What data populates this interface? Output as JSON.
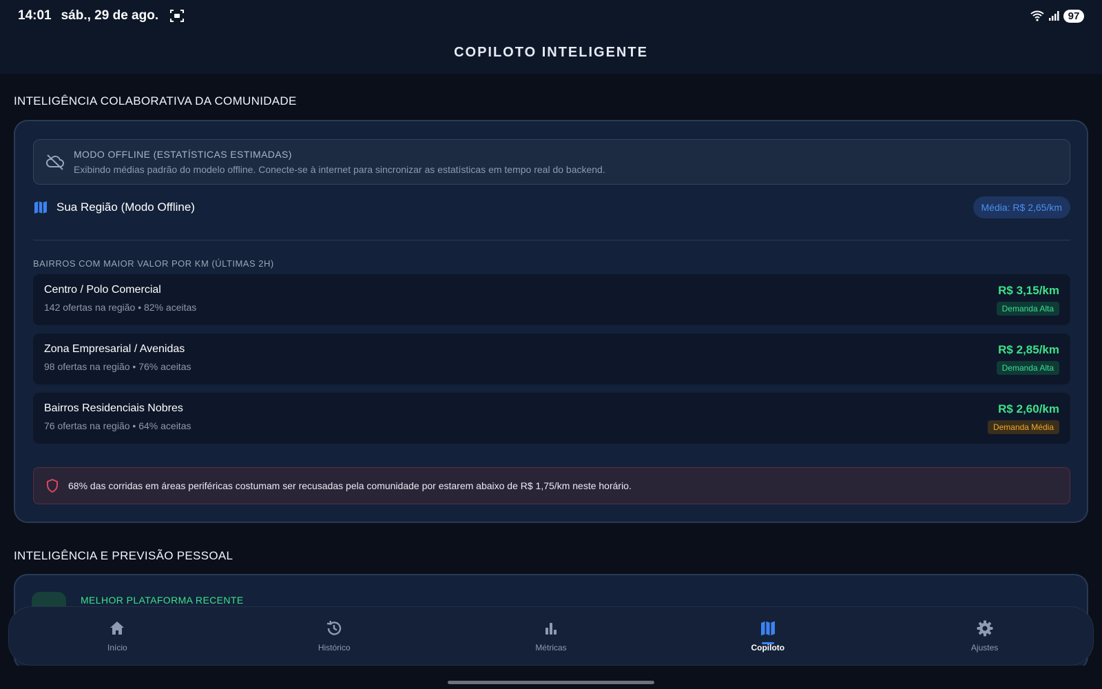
{
  "status_bar": {
    "time": "14:01",
    "date": "sáb., 29 de ago.",
    "battery": "97"
  },
  "header": {
    "title": "COPILOTO INTELIGENTE"
  },
  "community": {
    "section_title": "INTELIGÊNCIA COLABORATIVA DA COMUNIDADE",
    "offline": {
      "title": "MODO OFFLINE (ESTATÍSTICAS ESTIMADAS)",
      "description": "Exibindo médias padrão do modelo offline. Conecte-se à internet para sincronizar as estatísticas em tempo real do backend.",
      "icon": "cloud-off-icon"
    },
    "region": {
      "name": "Sua Região (Modo Offline)",
      "average": "Média: R$ 2,65/km",
      "icon": "map-icon"
    },
    "list_header": "BAIRROS COM MAIOR VALOR POR KM (ÚLTIMAS 2H)",
    "neighborhoods": [
      {
        "name": "Centro / Polo Comercial",
        "sub": "142 ofertas na região • 82% aceitas",
        "price": "R$ 3,15/km",
        "demand": "Demanda Alta",
        "level": "high"
      },
      {
        "name": "Zona Empresarial / Avenidas",
        "sub": "98 ofertas na região • 76% aceitas",
        "price": "R$ 2,85/km",
        "demand": "Demanda Alta",
        "level": "high"
      },
      {
        "name": "Bairros Residenciais Nobres",
        "sub": "76 ofertas na região • 64% aceitas",
        "price": "R$ 2,60/km",
        "demand": "Demanda Média",
        "level": "mid"
      }
    ],
    "alert": "68% das corridas em áreas periféricas costumam ser recusadas pela comunidade por estarem abaixo de R$ 1,75/km neste horário."
  },
  "personal": {
    "section_title": "INTELIGÊNCIA E PREVISÃO PESSOAL",
    "card_label": "MELHOR PLATAFORMA RECENTE"
  },
  "nav": {
    "items": [
      {
        "label": "Início",
        "icon": "home-icon"
      },
      {
        "label": "Histórico",
        "icon": "history-icon"
      },
      {
        "label": "Métricas",
        "icon": "bar-chart-icon"
      },
      {
        "label": "Copiloto",
        "icon": "map-icon",
        "active": true
      },
      {
        "label": "Ajustes",
        "icon": "gear-icon"
      }
    ]
  },
  "colors": {
    "accent": "#3d82f0",
    "positive": "#3ee18a",
    "warning": "#f5a623",
    "danger": "#e0455f"
  }
}
